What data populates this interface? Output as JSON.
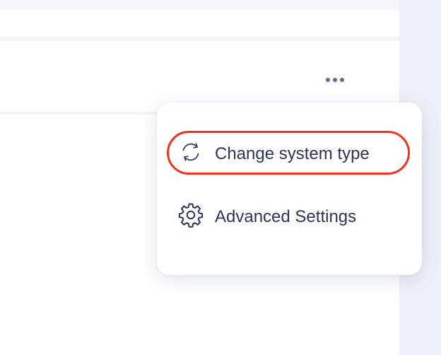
{
  "header": {
    "more_menu_icon": "ellipsis-horizontal-icon"
  },
  "dropdown": {
    "items": [
      {
        "label": "Change system type",
        "icon": "refresh-arrows-icon"
      },
      {
        "label": "Advanced Settings",
        "icon": "gear-icon"
      }
    ],
    "highlighted_item": "Change system type"
  },
  "colors": {
    "menu_text": "#2b3557",
    "icon_stroke": "#3a4468",
    "highlight_ring": "#f0331f",
    "more_dots": "#5c6b99",
    "side_panel": "#eef0f9"
  }
}
